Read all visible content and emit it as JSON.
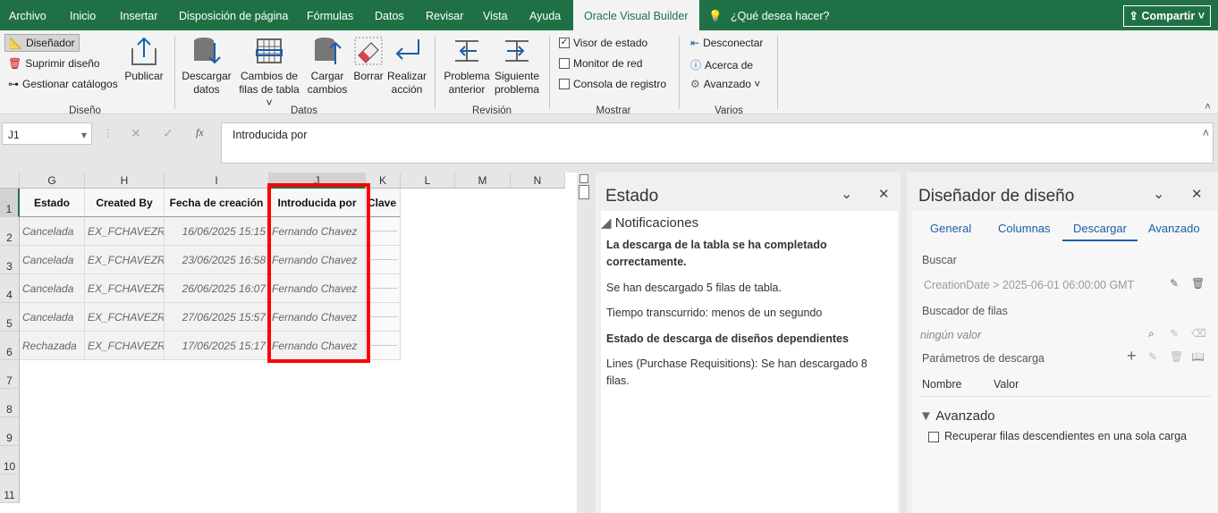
{
  "tabs": [
    "Archivo",
    "Inicio",
    "Insertar",
    "Disposición de página",
    "Fórmulas",
    "Datos",
    "Revisar",
    "Vista",
    "Ayuda",
    "Oracle Visual Builder"
  ],
  "tell_me": "¿Qué desea hacer?",
  "share": "Compartir",
  "ribbon": {
    "diseno": {
      "items": [
        "Diseñador",
        "Suprimir diseño",
        "Gestionar catálogos"
      ],
      "publish": "Publicar",
      "label": "Diseño"
    },
    "datos": {
      "buttons": [
        [
          "Descargar",
          "datos"
        ],
        [
          "Cambios de",
          "filas de tabla ˅"
        ],
        [
          "Cargar",
          "cambios"
        ],
        [
          "Borrar",
          ""
        ],
        [
          "Realizar",
          "acción"
        ]
      ],
      "label": "Datos"
    },
    "revision": {
      "buttons": [
        [
          "Problema",
          "anterior"
        ],
        [
          "Siguiente",
          "problema"
        ]
      ],
      "label": "Revisión"
    },
    "mostrar": {
      "items": [
        {
          "label": "Visor de estado",
          "checked": true
        },
        {
          "label": "Monitor de red",
          "checked": false
        },
        {
          "label": "Consola de registro",
          "checked": false
        }
      ],
      "label": "Mostrar"
    },
    "varios": {
      "items": [
        "Desconectar",
        "Acerca de",
        "Avanzado ˅"
      ],
      "label": "Varios"
    }
  },
  "formula": {
    "namebox": "J1",
    "fx": "fx",
    "value": "Introducida por"
  },
  "grid": {
    "columns": [
      "G",
      "H",
      "I",
      "J",
      "K",
      "L",
      "M",
      "N"
    ],
    "rows": [
      "1",
      "2",
      "3",
      "4",
      "5",
      "6",
      "7",
      "8",
      "9",
      "10",
      "11"
    ],
    "headers": [
      "Estado",
      "Created By",
      "Fecha de creación",
      "Introducida por",
      "Clave"
    ],
    "data": [
      [
        "Cancelada",
        "EX_FCHAVEZR",
        "16/06/2025 15:15",
        "Fernando Chavez"
      ],
      [
        "Cancelada",
        "EX_FCHAVEZR",
        "23/06/2025 16:58",
        "Fernando Chavez"
      ],
      [
        "Cancelada",
        "EX_FCHAVEZR",
        "26/06/2025 16:07",
        "Fernando Chavez"
      ],
      [
        "Cancelada",
        "EX_FCHAVEZR",
        "27/06/2025 15:57",
        "Fernando Chavez"
      ],
      [
        "Rechazada",
        "EX_FCHAVEZR",
        "17/06/2025 15:17",
        "Fernando Chavez"
      ]
    ]
  },
  "estado": {
    "title": "Estado",
    "section": "Notificaciones",
    "msg1": "La descarga de la tabla se ha completado correctamente.",
    "msg2": "Se han descargado 5 filas de tabla.",
    "msg3": "Tiempo transcurrido: menos de un segundo",
    "msg4": "Estado de descarga de diseños dependientes",
    "msg5": "Lines (Purchase Requisitions): Se han descargado 8 filas."
  },
  "designer": {
    "title": "Diseñador de diseño",
    "tabs": [
      "General",
      "Columnas",
      "Descargar",
      "Avanzado"
    ],
    "active_tab": "Descargar",
    "buscar": "Buscar",
    "filter": "CreationDate > 2025-06-01 06:00:00 GMT",
    "row_finder": "Buscador de filas",
    "row_finder_value": "ningún valor",
    "params": "Parámetros de descarga",
    "col_name": "Nombre",
    "col_value": "Valor",
    "advanced": "Avanzado",
    "advanced_option": "Recuperar filas descendientes en una sola carga"
  }
}
